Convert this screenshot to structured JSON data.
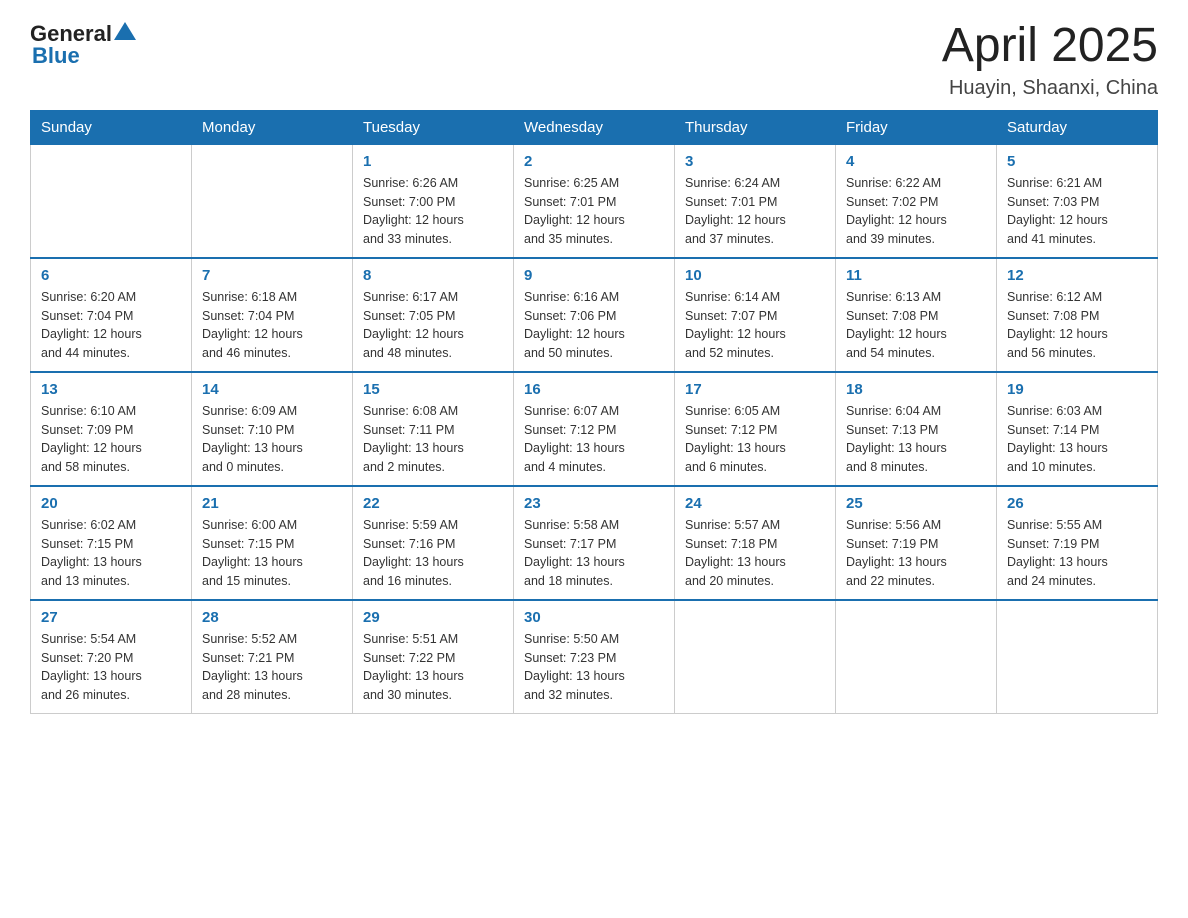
{
  "header": {
    "logo_general": "General",
    "logo_blue": "Blue",
    "month_year": "April 2025",
    "location": "Huayin, Shaanxi, China"
  },
  "weekdays": [
    "Sunday",
    "Monday",
    "Tuesday",
    "Wednesday",
    "Thursday",
    "Friday",
    "Saturday"
  ],
  "weeks": [
    [
      {
        "day": "",
        "info": ""
      },
      {
        "day": "",
        "info": ""
      },
      {
        "day": "1",
        "info": "Sunrise: 6:26 AM\nSunset: 7:00 PM\nDaylight: 12 hours\nand 33 minutes."
      },
      {
        "day": "2",
        "info": "Sunrise: 6:25 AM\nSunset: 7:01 PM\nDaylight: 12 hours\nand 35 minutes."
      },
      {
        "day": "3",
        "info": "Sunrise: 6:24 AM\nSunset: 7:01 PM\nDaylight: 12 hours\nand 37 minutes."
      },
      {
        "day": "4",
        "info": "Sunrise: 6:22 AM\nSunset: 7:02 PM\nDaylight: 12 hours\nand 39 minutes."
      },
      {
        "day": "5",
        "info": "Sunrise: 6:21 AM\nSunset: 7:03 PM\nDaylight: 12 hours\nand 41 minutes."
      }
    ],
    [
      {
        "day": "6",
        "info": "Sunrise: 6:20 AM\nSunset: 7:04 PM\nDaylight: 12 hours\nand 44 minutes."
      },
      {
        "day": "7",
        "info": "Sunrise: 6:18 AM\nSunset: 7:04 PM\nDaylight: 12 hours\nand 46 minutes."
      },
      {
        "day": "8",
        "info": "Sunrise: 6:17 AM\nSunset: 7:05 PM\nDaylight: 12 hours\nand 48 minutes."
      },
      {
        "day": "9",
        "info": "Sunrise: 6:16 AM\nSunset: 7:06 PM\nDaylight: 12 hours\nand 50 minutes."
      },
      {
        "day": "10",
        "info": "Sunrise: 6:14 AM\nSunset: 7:07 PM\nDaylight: 12 hours\nand 52 minutes."
      },
      {
        "day": "11",
        "info": "Sunrise: 6:13 AM\nSunset: 7:08 PM\nDaylight: 12 hours\nand 54 minutes."
      },
      {
        "day": "12",
        "info": "Sunrise: 6:12 AM\nSunset: 7:08 PM\nDaylight: 12 hours\nand 56 minutes."
      }
    ],
    [
      {
        "day": "13",
        "info": "Sunrise: 6:10 AM\nSunset: 7:09 PM\nDaylight: 12 hours\nand 58 minutes."
      },
      {
        "day": "14",
        "info": "Sunrise: 6:09 AM\nSunset: 7:10 PM\nDaylight: 13 hours\nand 0 minutes."
      },
      {
        "day": "15",
        "info": "Sunrise: 6:08 AM\nSunset: 7:11 PM\nDaylight: 13 hours\nand 2 minutes."
      },
      {
        "day": "16",
        "info": "Sunrise: 6:07 AM\nSunset: 7:12 PM\nDaylight: 13 hours\nand 4 minutes."
      },
      {
        "day": "17",
        "info": "Sunrise: 6:05 AM\nSunset: 7:12 PM\nDaylight: 13 hours\nand 6 minutes."
      },
      {
        "day": "18",
        "info": "Sunrise: 6:04 AM\nSunset: 7:13 PM\nDaylight: 13 hours\nand 8 minutes."
      },
      {
        "day": "19",
        "info": "Sunrise: 6:03 AM\nSunset: 7:14 PM\nDaylight: 13 hours\nand 10 minutes."
      }
    ],
    [
      {
        "day": "20",
        "info": "Sunrise: 6:02 AM\nSunset: 7:15 PM\nDaylight: 13 hours\nand 13 minutes."
      },
      {
        "day": "21",
        "info": "Sunrise: 6:00 AM\nSunset: 7:15 PM\nDaylight: 13 hours\nand 15 minutes."
      },
      {
        "day": "22",
        "info": "Sunrise: 5:59 AM\nSunset: 7:16 PM\nDaylight: 13 hours\nand 16 minutes."
      },
      {
        "day": "23",
        "info": "Sunrise: 5:58 AM\nSunset: 7:17 PM\nDaylight: 13 hours\nand 18 minutes."
      },
      {
        "day": "24",
        "info": "Sunrise: 5:57 AM\nSunset: 7:18 PM\nDaylight: 13 hours\nand 20 minutes."
      },
      {
        "day": "25",
        "info": "Sunrise: 5:56 AM\nSunset: 7:19 PM\nDaylight: 13 hours\nand 22 minutes."
      },
      {
        "day": "26",
        "info": "Sunrise: 5:55 AM\nSunset: 7:19 PM\nDaylight: 13 hours\nand 24 minutes."
      }
    ],
    [
      {
        "day": "27",
        "info": "Sunrise: 5:54 AM\nSunset: 7:20 PM\nDaylight: 13 hours\nand 26 minutes."
      },
      {
        "day": "28",
        "info": "Sunrise: 5:52 AM\nSunset: 7:21 PM\nDaylight: 13 hours\nand 28 minutes."
      },
      {
        "day": "29",
        "info": "Sunrise: 5:51 AM\nSunset: 7:22 PM\nDaylight: 13 hours\nand 30 minutes."
      },
      {
        "day": "30",
        "info": "Sunrise: 5:50 AM\nSunset: 7:23 PM\nDaylight: 13 hours\nand 32 minutes."
      },
      {
        "day": "",
        "info": ""
      },
      {
        "day": "",
        "info": ""
      },
      {
        "day": "",
        "info": ""
      }
    ]
  ]
}
